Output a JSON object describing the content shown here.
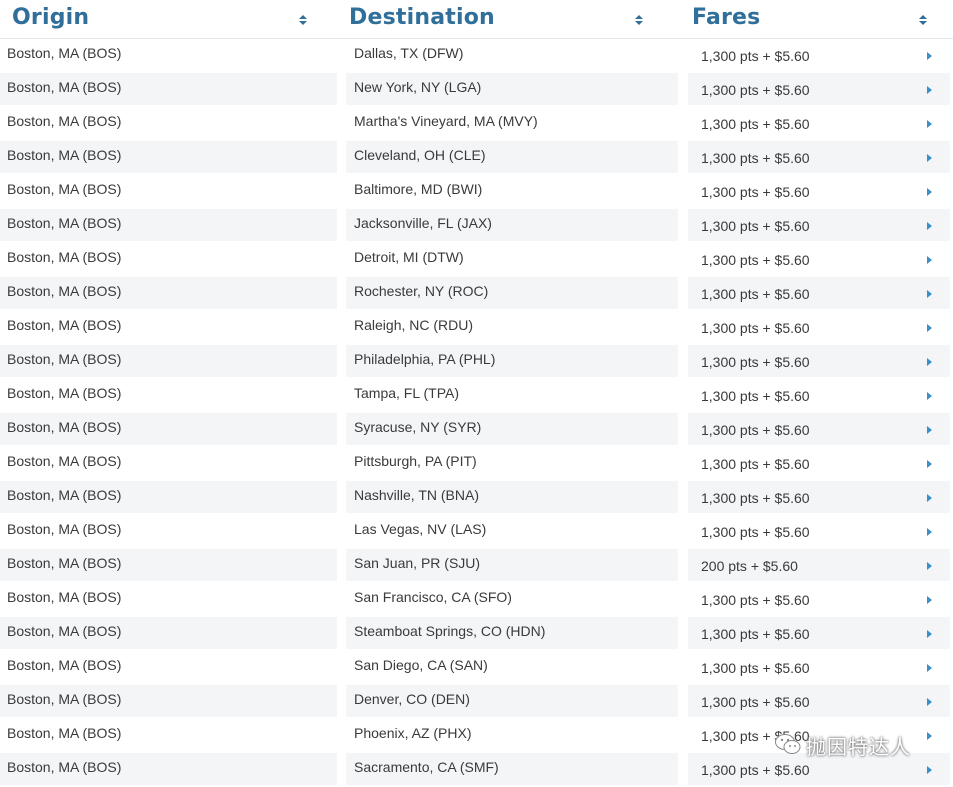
{
  "header": {
    "origin_label": "Origin",
    "destination_label": "Destination",
    "fares_label": "Fares"
  },
  "rows": [
    {
      "origin": "Boston, MA (BOS)",
      "destination": "Dallas, TX (DFW)",
      "fare": "1,300 pts + $5.60"
    },
    {
      "origin": "Boston, MA (BOS)",
      "destination": "New York, NY (LGA)",
      "fare": "1,300 pts + $5.60"
    },
    {
      "origin": "Boston, MA (BOS)",
      "destination": "Martha's Vineyard, MA (MVY)",
      "fare": "1,300 pts + $5.60"
    },
    {
      "origin": "Boston, MA (BOS)",
      "destination": "Cleveland, OH (CLE)",
      "fare": "1,300 pts + $5.60"
    },
    {
      "origin": "Boston, MA (BOS)",
      "destination": "Baltimore, MD (BWI)",
      "fare": "1,300 pts + $5.60"
    },
    {
      "origin": "Boston, MA (BOS)",
      "destination": "Jacksonville, FL (JAX)",
      "fare": "1,300 pts + $5.60"
    },
    {
      "origin": "Boston, MA (BOS)",
      "destination": "Detroit, MI (DTW)",
      "fare": "1,300 pts + $5.60"
    },
    {
      "origin": "Boston, MA (BOS)",
      "destination": "Rochester, NY (ROC)",
      "fare": "1,300 pts + $5.60"
    },
    {
      "origin": "Boston, MA (BOS)",
      "destination": "Raleigh, NC (RDU)",
      "fare": "1,300 pts + $5.60"
    },
    {
      "origin": "Boston, MA (BOS)",
      "destination": "Philadelphia, PA (PHL)",
      "fare": "1,300 pts + $5.60"
    },
    {
      "origin": "Boston, MA (BOS)",
      "destination": "Tampa, FL (TPA)",
      "fare": "1,300 pts + $5.60"
    },
    {
      "origin": "Boston, MA (BOS)",
      "destination": "Syracuse, NY (SYR)",
      "fare": "1,300 pts + $5.60"
    },
    {
      "origin": "Boston, MA (BOS)",
      "destination": "Pittsburgh, PA (PIT)",
      "fare": "1,300 pts + $5.60"
    },
    {
      "origin": "Boston, MA (BOS)",
      "destination": "Nashville, TN (BNA)",
      "fare": "1,300 pts + $5.60"
    },
    {
      "origin": "Boston, MA (BOS)",
      "destination": "Las Vegas, NV (LAS)",
      "fare": "1,300 pts + $5.60"
    },
    {
      "origin": "Boston, MA (BOS)",
      "destination": "San Juan, PR (SJU)",
      "fare": "200 pts + $5.60"
    },
    {
      "origin": "Boston, MA (BOS)",
      "destination": "San Francisco, CA (SFO)",
      "fare": "1,300 pts + $5.60"
    },
    {
      "origin": "Boston, MA (BOS)",
      "destination": "Steamboat Springs, CO (HDN)",
      "fare": "1,300 pts + $5.60"
    },
    {
      "origin": "Boston, MA (BOS)",
      "destination": "San Diego, CA (SAN)",
      "fare": "1,300 pts + $5.60"
    },
    {
      "origin": "Boston, MA (BOS)",
      "destination": "Denver, CO (DEN)",
      "fare": "1,300 pts + $5.60"
    },
    {
      "origin": "Boston, MA (BOS)",
      "destination": "Phoenix, AZ (PHX)",
      "fare": "1,300 pts + $5.60"
    },
    {
      "origin": "Boston, MA (BOS)",
      "destination": "Sacramento, CA (SMF)",
      "fare": "1,300 pts + $5.60"
    }
  ],
  "icons": {
    "sort": "sort-icon",
    "row_arrow": "chevron-right-icon",
    "watermark": "wechat-icon"
  },
  "watermark": {
    "text": "抛因特达人"
  },
  "colors": {
    "header_text": "#2f6f9a",
    "arrow": "#3b8fc8",
    "alt_row": "#f3f5f7"
  }
}
